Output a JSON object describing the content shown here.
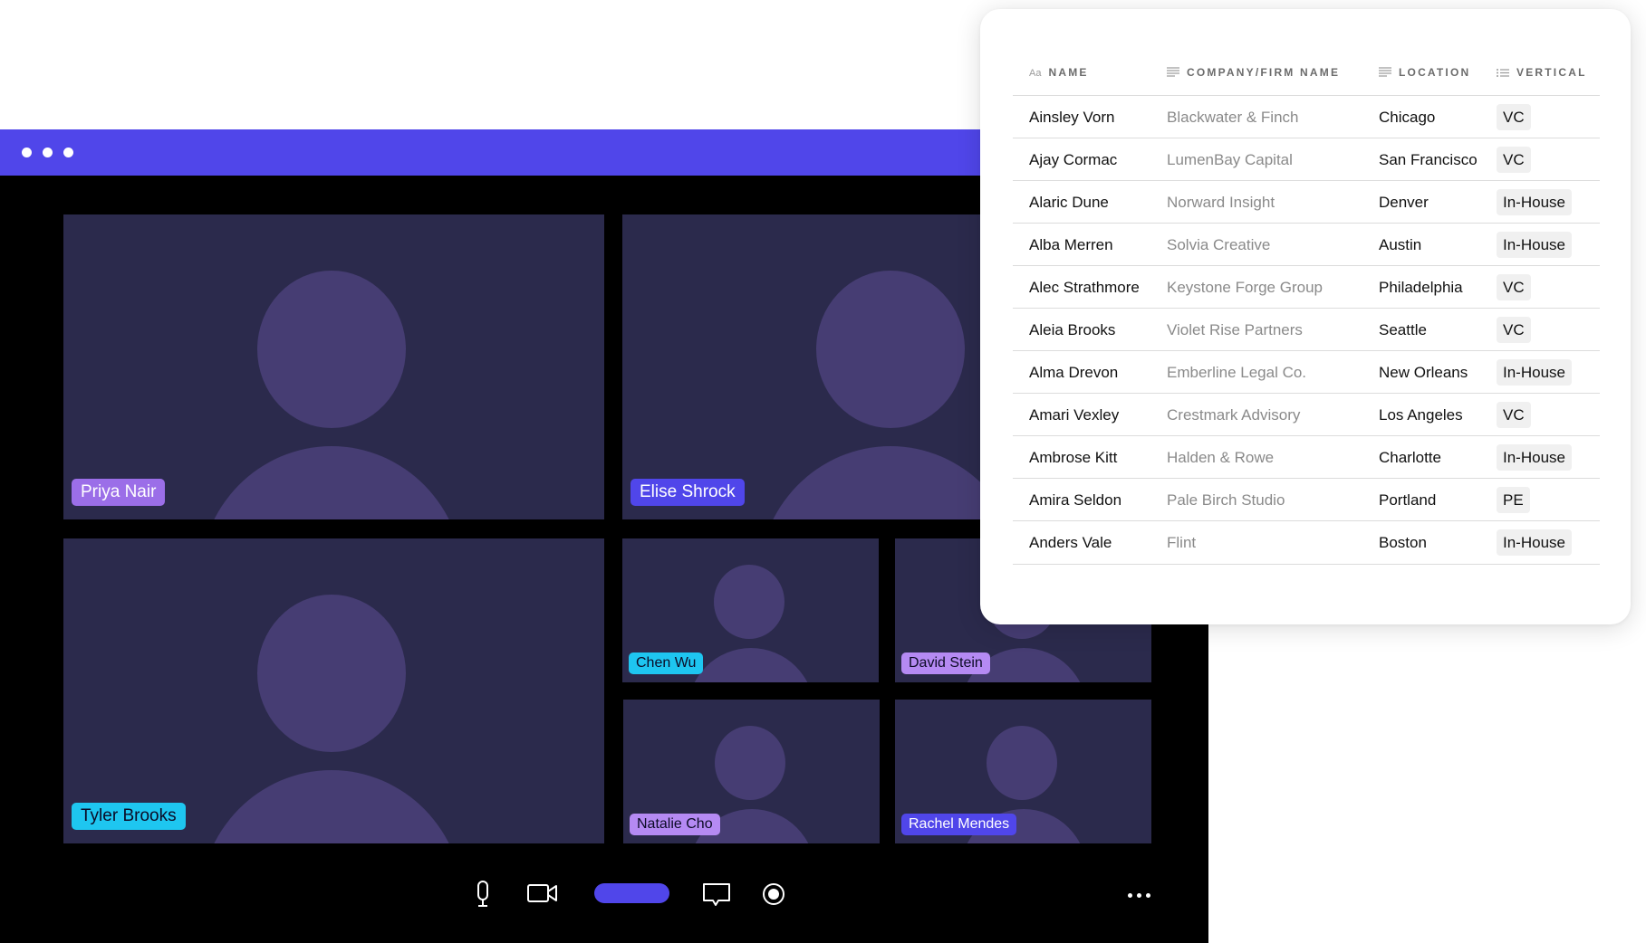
{
  "window": {
    "participants": [
      {
        "name": "Priya Nair",
        "tag_color": "#9b6ee8",
        "text_dark": false
      },
      {
        "name": "Elise Shrock",
        "tag_color": "#5046ea",
        "text_dark": false
      },
      {
        "name": "Tyler Brooks",
        "tag_color": "#1ec6f0",
        "text_dark": true
      },
      {
        "name": "Chen Wu",
        "tag_color": "#1ec6f0",
        "text_dark": true
      },
      {
        "name": "David Stein",
        "tag_color": "#b58af3",
        "text_dark": true
      },
      {
        "name": "Natalie Cho",
        "tag_color": "#b58af3",
        "text_dark": true
      },
      {
        "name": "Rachel Mendes",
        "tag_color": "#5046ea",
        "text_dark": false
      }
    ],
    "controls": [
      "microphone-icon",
      "camera-icon",
      "share-pill",
      "chat-icon",
      "record-icon",
      "more-icon"
    ]
  },
  "table": {
    "headers": {
      "name_icon": "Aa",
      "name": "NAME",
      "company": "COMPANY/FIRM NAME",
      "location": "LOCATION",
      "vertical": "VERTICAL"
    },
    "rows": [
      {
        "name": "Ainsley Vorn",
        "company": "Blackwater & Finch",
        "location": "Chicago",
        "vertical": "VC"
      },
      {
        "name": "Ajay Cormac",
        "company": "LumenBay Capital",
        "location": "San Francisco",
        "vertical": "VC"
      },
      {
        "name": "Alaric Dune",
        "company": "Norward Insight",
        "location": "Denver",
        "vertical": "In-House"
      },
      {
        "name": "Alba Merren",
        "company": "Solvia Creative",
        "location": "Austin",
        "vertical": "In-House"
      },
      {
        "name": "Alec Strathmore",
        "company": "Keystone Forge Group",
        "location": "Philadelphia",
        "vertical": "VC"
      },
      {
        "name": "Aleia Brooks",
        "company": "Violet Rise Partners",
        "location": "Seattle",
        "vertical": "VC"
      },
      {
        "name": "Alma Drevon",
        "company": "Emberline Legal Co.",
        "location": "New Orleans",
        "vertical": "In-House"
      },
      {
        "name": "Amari Vexley",
        "company": "Crestmark Advisory",
        "location": "Los Angeles",
        "vertical": "VC"
      },
      {
        "name": "Ambrose Kitt",
        "company": "Halden & Rowe",
        "location": "Charlotte",
        "vertical": "In-House"
      },
      {
        "name": "Amira Seldon",
        "company": "Pale Birch Studio",
        "location": "Portland",
        "vertical": "PE"
      },
      {
        "name": "Anders Vale",
        "company": "Flint",
        "location": "Boston",
        "vertical": "In-House"
      }
    ]
  }
}
